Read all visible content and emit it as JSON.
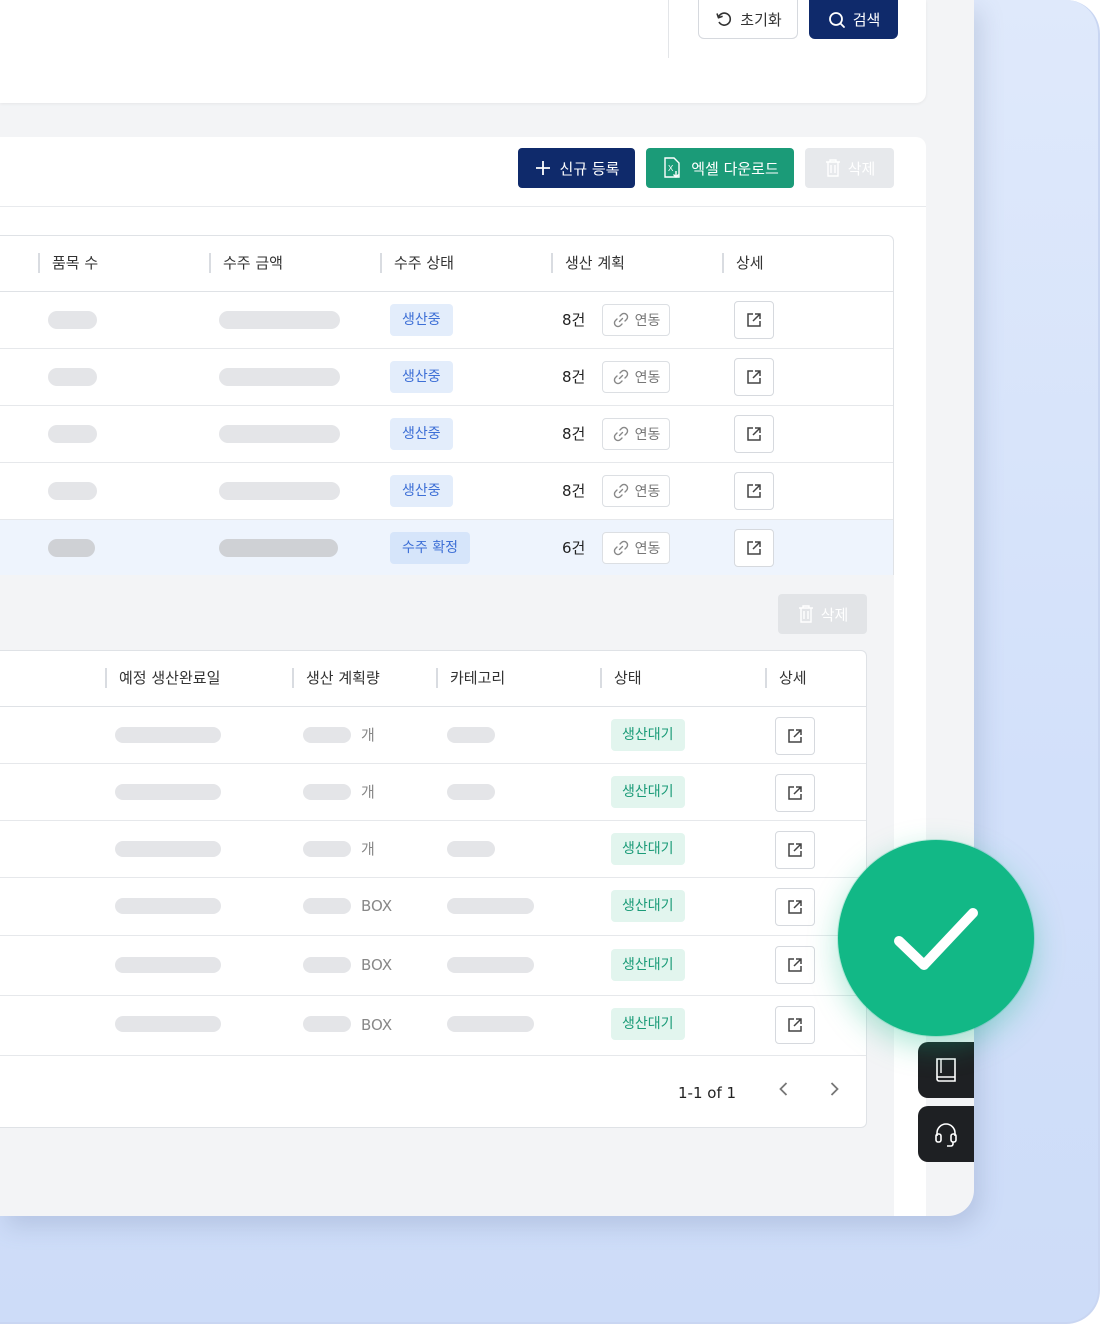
{
  "search": {
    "reset_label": "초기화",
    "search_label": "검색"
  },
  "toolbar": {
    "new_label": "신규 등록",
    "excel_label": "엑셀 다운로드",
    "delete_label": "삭제"
  },
  "order_table": {
    "headers": [
      "품목 수",
      "수주 금액",
      "수주 상태",
      "생산 계획",
      "상세"
    ],
    "rows": [
      {
        "status": "생산중",
        "plan_count": "8건",
        "link_label": "연동"
      },
      {
        "status": "생산중",
        "plan_count": "8건",
        "link_label": "연동"
      },
      {
        "status": "생산중",
        "plan_count": "8건",
        "link_label": "연동"
      },
      {
        "status": "생산중",
        "plan_count": "8건",
        "link_label": "연동"
      },
      {
        "status": "수주 확정",
        "plan_count": "6건",
        "link_label": "연동"
      }
    ]
  },
  "plan_section": {
    "delete_label": "삭제",
    "headers": [
      "예정 생산완료일",
      "생산 계획량",
      "카테고리",
      "상태",
      "상세"
    ],
    "rows": [
      {
        "unit": "개",
        "status": "생산대기"
      },
      {
        "unit": "개",
        "status": "생산대기"
      },
      {
        "unit": "개",
        "status": "생산대기"
      },
      {
        "unit": "BOX",
        "status": "생산대기"
      },
      {
        "unit": "BOX",
        "status": "생산대기"
      },
      {
        "unit": "BOX",
        "status": "생산대기"
      }
    ],
    "pagination": "1-1 of 1"
  },
  "colors": {
    "navy": "#0f2a6b",
    "green": "#1b9b78",
    "check": "#12b886",
    "blue_status": "#3d6fd6"
  }
}
